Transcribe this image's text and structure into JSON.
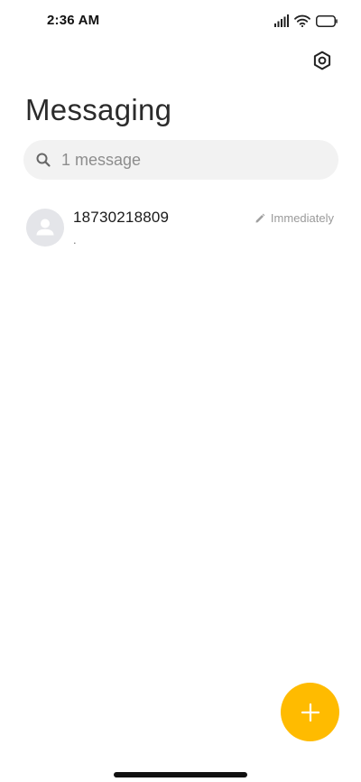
{
  "status_bar": {
    "time": "2:36 AM",
    "icons": [
      "signal-icon",
      "wifi-icon",
      "battery-icon"
    ]
  },
  "header": {
    "title": "Messaging",
    "settings_icon": "settings-icon"
  },
  "search": {
    "placeholder": "1 message",
    "icon": "search-icon"
  },
  "conversations": [
    {
      "name": "18730218809",
      "preview": ".",
      "timestamp": "Immediately",
      "status_icon": "draft-pencil-icon",
      "avatar_icon": "default-contact-avatar-icon"
    }
  ],
  "fab": {
    "icon": "plus-icon",
    "color": "#ffbb00"
  },
  "colors": {
    "accent": "#ffbb00",
    "search_background": "#f2f2f2",
    "avatar_background": "#e4e5e9"
  }
}
